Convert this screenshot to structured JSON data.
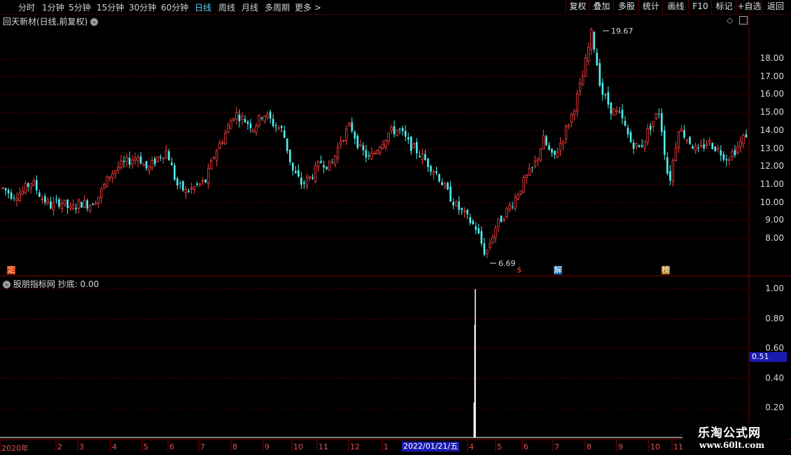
{
  "toolbar": {
    "periods": [
      "分时",
      "1分钟",
      "5分钟",
      "15分钟",
      "30分钟",
      "60分钟",
      "日线",
      "周线",
      "月线",
      "多周期",
      "更多 >"
    ],
    "active_period": "日线",
    "buttons": [
      "复权",
      "叠加",
      "多股",
      "统计",
      "画线",
      "F10",
      "标记",
      "+自选",
      "返回"
    ]
  },
  "chart_header": {
    "title": "回天新材(日线,前复权)"
  },
  "price_chart": {
    "y_ticks": [
      "18.00",
      "17.00",
      "16.00",
      "15.00",
      "14.00",
      "13.00",
      "12.00",
      "11.00",
      "10.00",
      "9.00",
      "8.00"
    ],
    "high_label": "19.67",
    "low_label": "6.69",
    "markers": [
      "定",
      "$",
      "解",
      "榜"
    ]
  },
  "indicator": {
    "title": "股朋指标网  抄底: 0.00",
    "y_ticks": [
      "1.00",
      "0.80",
      "0.60",
      "0.40",
      "0.20"
    ],
    "cursor_value": "0.51"
  },
  "time_axis": {
    "labels": [
      "2020年",
      "2",
      "3",
      "4",
      "5",
      "6",
      "7",
      "8",
      "9",
      "10",
      "11",
      "12",
      "1",
      "4",
      "5",
      "6",
      "7",
      "8",
      "9",
      "10",
      "11"
    ],
    "cursor_date": "2022/01/21/五"
  },
  "watermark": {
    "brand": "乐淘公式网",
    "url": "www.60lt.com"
  },
  "colors": {
    "up": "#ff4040",
    "down": "#4ff0f0",
    "grid": "#7a0000",
    "active": "#5ad0ff"
  },
  "chart_data": {
    "type": "candlestick",
    "y_unit": "price",
    "ylim": [
      6.5,
      20.5
    ],
    "high": 19.67,
    "low": 6.69,
    "close_path": [
      10.8,
      10.4,
      10.6,
      11.2,
      10.3,
      9.8,
      10.1,
      9.6,
      10.0,
      9.9,
      10.4,
      11.5,
      12.0,
      12.3,
      12.6,
      11.8,
      12.5,
      12.9,
      11.0,
      10.6,
      10.9,
      11.2,
      12.8,
      13.8,
      15.0,
      14.6,
      14.2,
      15.0,
      14.4,
      14.0,
      11.8,
      11.0,
      11.5,
      12.3,
      12.0,
      13.5,
      14.3,
      13.0,
      12.4,
      13.2,
      13.9,
      14.1,
      13.3,
      12.8,
      12.2,
      11.6,
      10.6,
      9.8,
      9.2,
      8.6,
      7.1,
      8.6,
      9.4,
      10.2,
      11.2,
      12.0,
      13.5,
      12.4,
      13.6,
      15.0,
      16.8,
      19.5,
      16.2,
      15.2,
      14.8,
      13.4,
      13.0,
      14.2,
      15.1,
      11.0,
      14.2,
      13.5,
      12.8,
      13.4,
      13.0,
      12.5,
      13.0,
      13.8
    ],
    "indicator_series": {
      "name": "抄底",
      "peak_value": 1.0,
      "peak_date": "2022/01/21",
      "value": 0.0
    }
  }
}
